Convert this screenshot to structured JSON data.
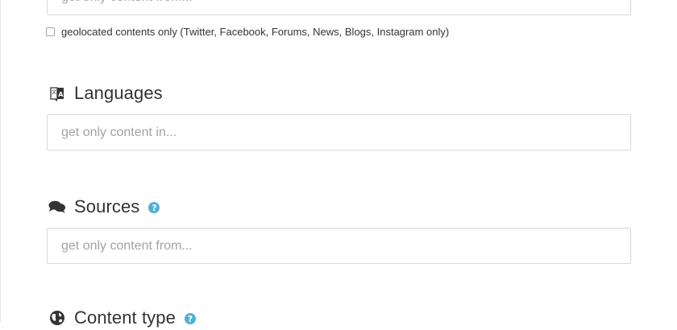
{
  "location": {
    "placeholder": "get only content from..."
  },
  "geolocated": {
    "label": "geolocated contents only (Twitter, Facebook, Forums, News, Blogs, Instagram only)"
  },
  "languages": {
    "heading": "Languages",
    "icon": "language-icon",
    "placeholder": "get only content in..."
  },
  "sources": {
    "heading": "Sources",
    "icon": "comments-icon",
    "placeholder": "get only content from...",
    "help_icon": "question-icon",
    "help_glyph": "?"
  },
  "content_type": {
    "heading": "Content type",
    "icon": "globe-icon",
    "help_icon": "question-icon",
    "help_glyph": "?"
  },
  "colors": {
    "help_icon": "#4fb0d4",
    "input_border": "#d9d9d9",
    "placeholder": "#a3a3a3",
    "text": "#333333"
  }
}
